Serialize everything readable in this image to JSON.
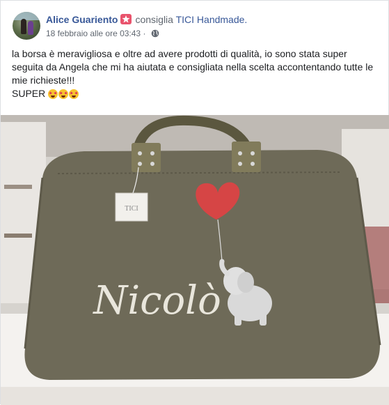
{
  "post": {
    "author": "Alice Guariento",
    "action": "consiglia",
    "page": "TICI Handmade.",
    "timestamp": "18 febbraio alle ore 03:43",
    "separator": "·",
    "privacy_icon": "globe-icon",
    "badge_icon": "recommend-star-icon",
    "text_lines": [
      "la borsa è meravigliosa e oltre ad avere prodotti di qualità, io sono stata super seguita da Angela che mi ha aiutata e consigliata nella scelta accontentando tutte le mie richieste!!!",
      "SUPER"
    ],
    "emojis": [
      "star-struck-emoji",
      "star-struck-emoji",
      "star-struck-emoji"
    ]
  },
  "photo": {
    "tag_text": "TICI",
    "embroidered_name": "Nicolò",
    "motif": "elephant-with-heart-balloon"
  },
  "colors": {
    "link": "#385898",
    "secondary": "#606770",
    "badge": "#e9536c",
    "bag": "#6e6a58"
  }
}
